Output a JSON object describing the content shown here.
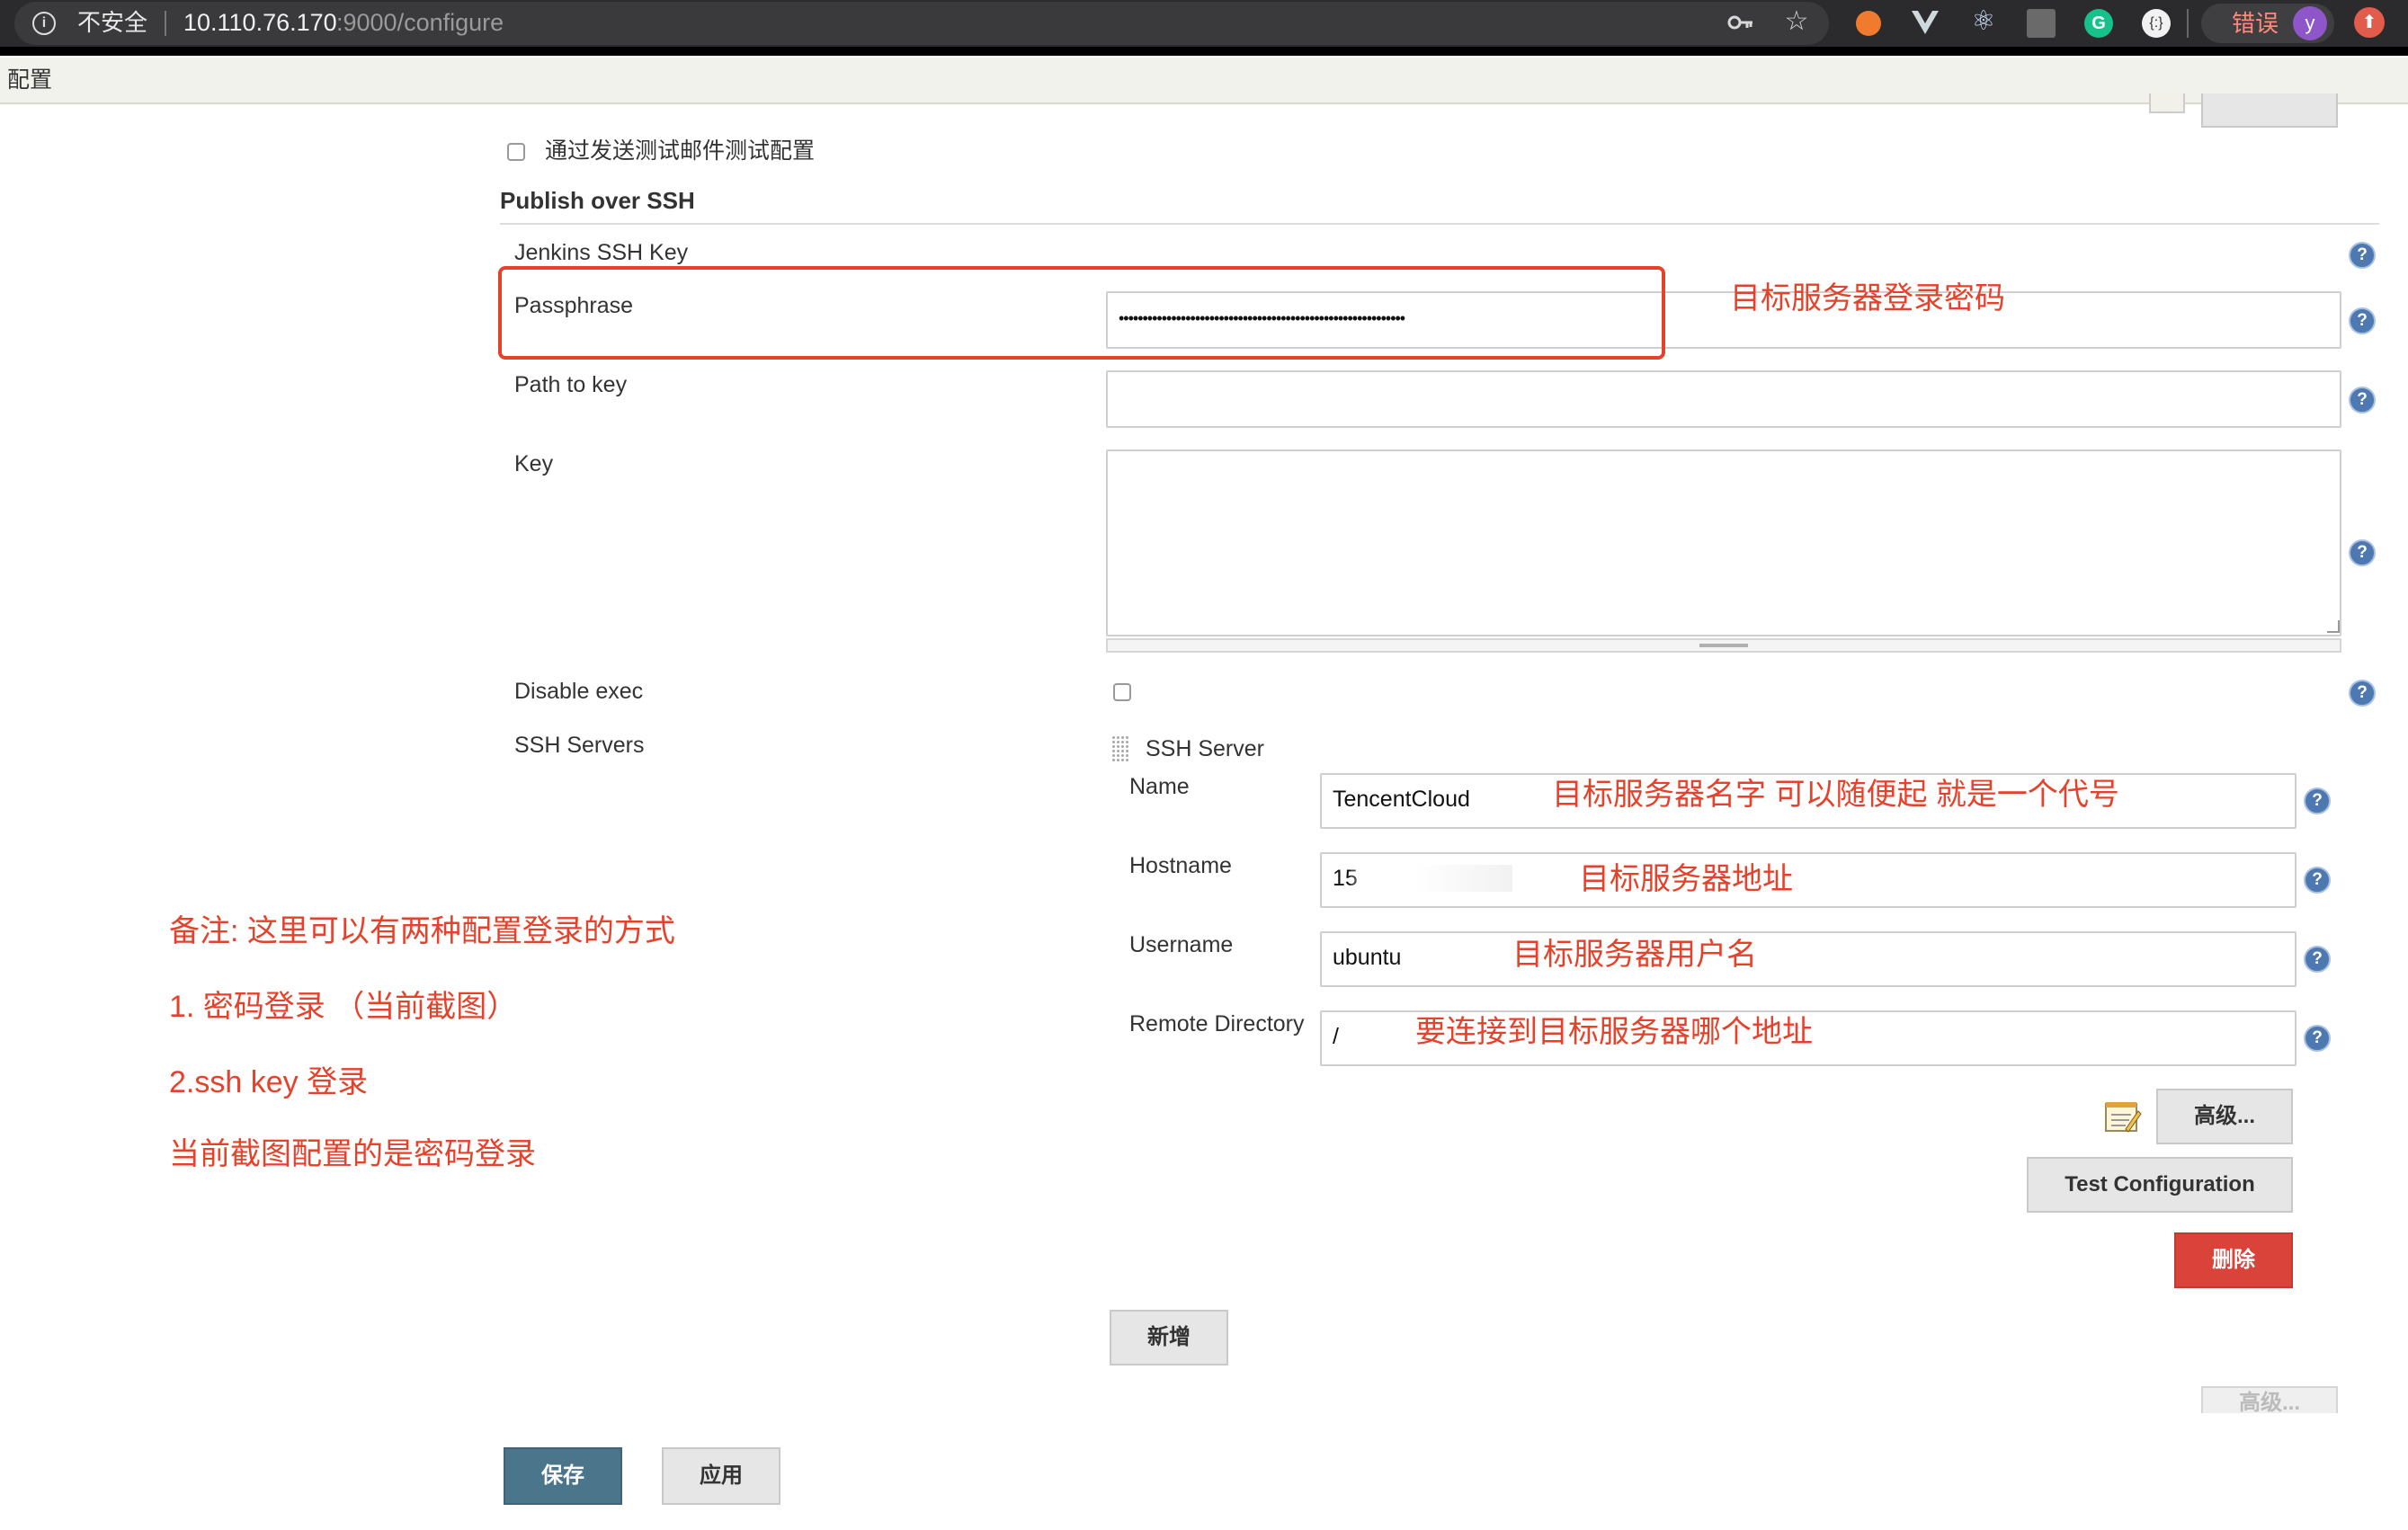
{
  "browser": {
    "security_label": "不安全",
    "url_host": "10.110.76.170",
    "url_path": ":9000/configure",
    "error_label": "错误",
    "profile_initial": "y"
  },
  "breadcrumb": {
    "label": "配置"
  },
  "form": {
    "test_mail_label": "通过发送测试邮件测试配置",
    "section_title": "Publish over SSH",
    "jenkins_ssh_key_label": "Jenkins SSH Key",
    "passphrase_label": "Passphrase",
    "passphrase_value": "••••••••••••••••••••••••••••••••••••••••••••••••••••••••••••",
    "path_to_key_label": "Path to key",
    "path_to_key_value": "",
    "key_label": "Key",
    "key_value": "",
    "disable_exec_label": "Disable exec",
    "ssh_servers_label": "SSH Servers",
    "ssh_server_title": "SSH Server",
    "name_label": "Name",
    "name_value": "TencentCloud",
    "hostname_label": "Hostname",
    "hostname_value": "15",
    "username_label": "Username",
    "username_value": "ubuntu",
    "remote_dir_label": "Remote Directory",
    "remote_dir_value": "/",
    "advanced_button": "高级...",
    "test_config_button": "Test Configuration",
    "delete_button": "删除",
    "add_button": "新增",
    "advanced_button_outer": "高级...",
    "save_button": "保存",
    "apply_button": "应用",
    "help_glyph": "?"
  },
  "annotations": {
    "passphrase": "目标服务器登录密码",
    "name": "目标服务器名字 可以随便起 就是一个代号",
    "hostname": "目标服务器地址",
    "username": "目标服务器用户名",
    "remote_dir": "要连接到目标服务器哪个地址",
    "note_1": "备注: 这里可以有两种配置登录的方式",
    "note_2": "1. 密码登录 （当前截图）",
    "note_3": "2.ssh key 登录",
    "note_4": "当前截图配置的是密码登录"
  },
  "colors": {
    "annotation_red": "#e6412a",
    "delete_red": "#d9433a",
    "save_blue": "#4b758b",
    "help_blue": "#4e78b0"
  }
}
